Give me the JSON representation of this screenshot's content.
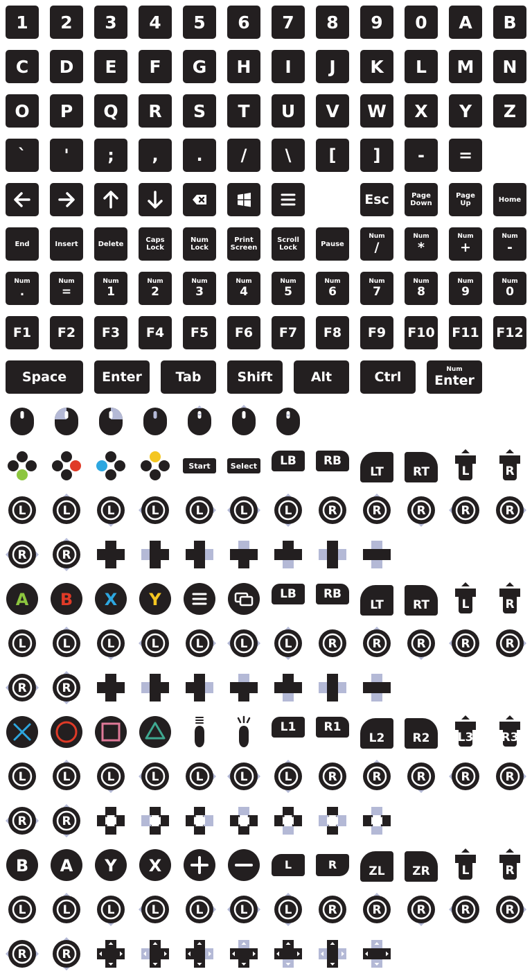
{
  "colors": {
    "key": "#231f20",
    "accent": "#b4b9d6",
    "xbox_a": "#8dc63f",
    "xbox_b": "#e03a27",
    "xbox_x": "#2da7e0",
    "xbox_y": "#f4c621",
    "ps_cross": "#2da7e0",
    "ps_circle": "#e03a27",
    "ps_square": "#e07a98",
    "ps_triangle": "#3fa890"
  },
  "keyboard": {
    "row1": [
      "1",
      "2",
      "3",
      "4",
      "5",
      "6",
      "7",
      "8",
      "9",
      "0",
      "A",
      "B"
    ],
    "row2": [
      "C",
      "D",
      "E",
      "F",
      "G",
      "H",
      "I",
      "J",
      "K",
      "L",
      "M",
      "N"
    ],
    "row3": [
      "O",
      "P",
      "Q",
      "R",
      "S",
      "T",
      "U",
      "V",
      "W",
      "X",
      "Y",
      "Z"
    ],
    "row4": [
      "`",
      "'",
      ";",
      ",",
      ".",
      "/",
      "\\",
      "[",
      "]",
      "-",
      "="
    ],
    "esc": "Esc",
    "page_down": [
      "Page",
      "Down"
    ],
    "page_up": [
      "Page",
      "Up"
    ],
    "home": "Home",
    "row6": [
      [
        "End"
      ],
      [
        "Insert"
      ],
      [
        "Delete"
      ],
      [
        "Caps",
        "Lock"
      ],
      [
        "Num",
        "Lock"
      ],
      [
        "Print",
        "Screen"
      ],
      [
        "Scroll",
        "Lock"
      ],
      [
        "Pause"
      ]
    ],
    "num_prefix": "Num",
    "row6_num": [
      "/",
      "*",
      "+",
      "-"
    ],
    "row7_num": [
      ".",
      "=",
      "1",
      "2",
      "3",
      "4",
      "5",
      "6",
      "7",
      "8",
      "9",
      "0"
    ],
    "fkeys": [
      "F1",
      "F2",
      "F3",
      "F4",
      "F5",
      "F6",
      "F7",
      "F8",
      "F9",
      "F10",
      "F11",
      "F12"
    ],
    "wide": [
      "Space",
      "Enter",
      "Tab",
      "Shift",
      "Alt",
      "Ctrl"
    ],
    "num_enter": [
      "Num",
      "Enter"
    ]
  },
  "generic_pad": {
    "start": "Start",
    "select": "Select",
    "lb": "LB",
    "rb": "RB",
    "lt": "LT",
    "rt": "RT",
    "l": "L",
    "r": "R"
  },
  "xbox": {
    "a": "A",
    "b": "B",
    "x": "X",
    "y": "Y",
    "lb": "LB",
    "rb": "RB",
    "lt": "LT",
    "rt": "RT",
    "l": "L",
    "r": "R"
  },
  "playstation": {
    "l1": "L1",
    "r1": "R1",
    "l2": "L2",
    "r2": "R2",
    "l3": "L3",
    "r3": "R3",
    "l": "L",
    "r": "R"
  },
  "switch": {
    "b": "B",
    "a": "A",
    "y": "Y",
    "x": "X",
    "l": "L",
    "r": "R",
    "zl": "ZL",
    "zr": "ZR"
  },
  "icons": {
    "row5": [
      "left-arrow-icon",
      "right-arrow-icon",
      "up-arrow-icon",
      "down-arrow-icon",
      "backspace-icon",
      "windows-icon",
      "menu-icon"
    ],
    "mouse": [
      "mouse-icon",
      "mouse-left-click-icon",
      "mouse-right-click-icon",
      "mouse-middle-click-icon",
      "mouse-scroll-icon",
      "mouse-scroll-up-icon",
      "mouse-scroll-down-icon"
    ],
    "stick_dirs": [
      "press",
      "up",
      "down",
      "left",
      "right",
      "left",
      "right"
    ],
    "dpad_variants": [
      "plain",
      "left",
      "right",
      "up",
      "down",
      "horizontal",
      "vertical"
    ],
    "ps_touch": [
      "touchpad-swipe-icon",
      "touchpad-tap-icon"
    ]
  }
}
